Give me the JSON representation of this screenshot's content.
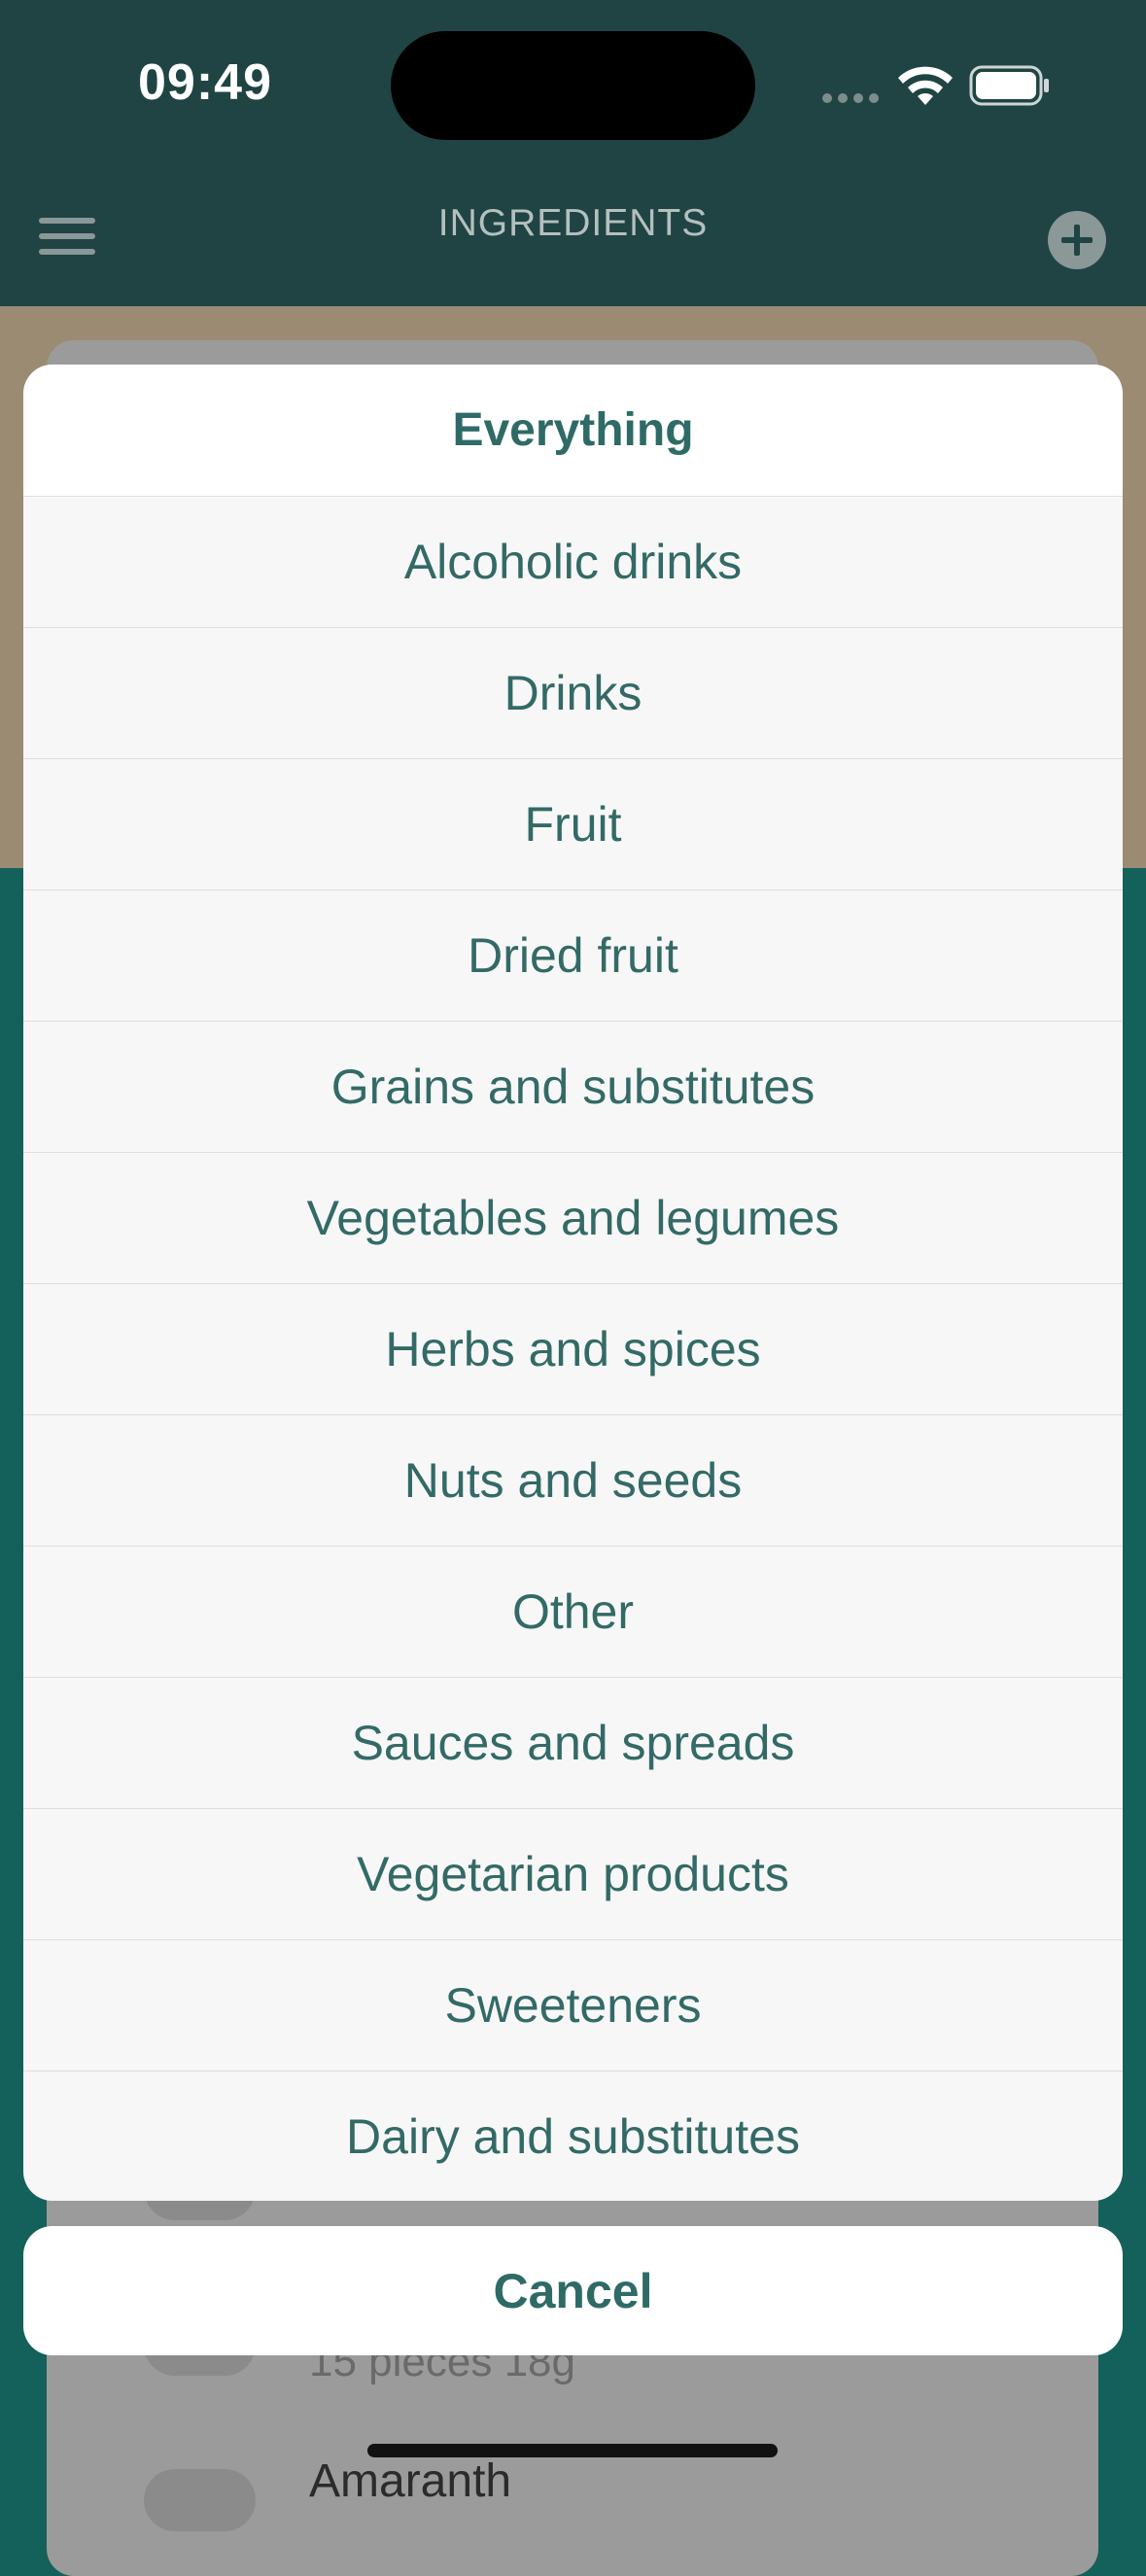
{
  "status_bar": {
    "time": "09:49"
  },
  "header": {
    "title": "INGREDIENTS"
  },
  "background_list": {
    "visible_subtitle": "15 pieces 18g",
    "visible_title": "Amaranth"
  },
  "action_sheet": {
    "title": "Everything",
    "options": [
      "Alcoholic drinks",
      "Drinks",
      "Fruit",
      "Dried fruit",
      "Grains and substitutes",
      "Vegetables and legumes",
      "Herbs and spices",
      "Nuts and seeds",
      "Other",
      "Sauces and spreads",
      "Vegetarian products",
      "Sweeteners",
      "Dairy and substitutes"
    ],
    "cancel_label": "Cancel"
  },
  "colors": {
    "header_bg": "#1f4443",
    "accent_text": "#336a66",
    "tan": "#9b8b72",
    "teal": "#14605b"
  }
}
